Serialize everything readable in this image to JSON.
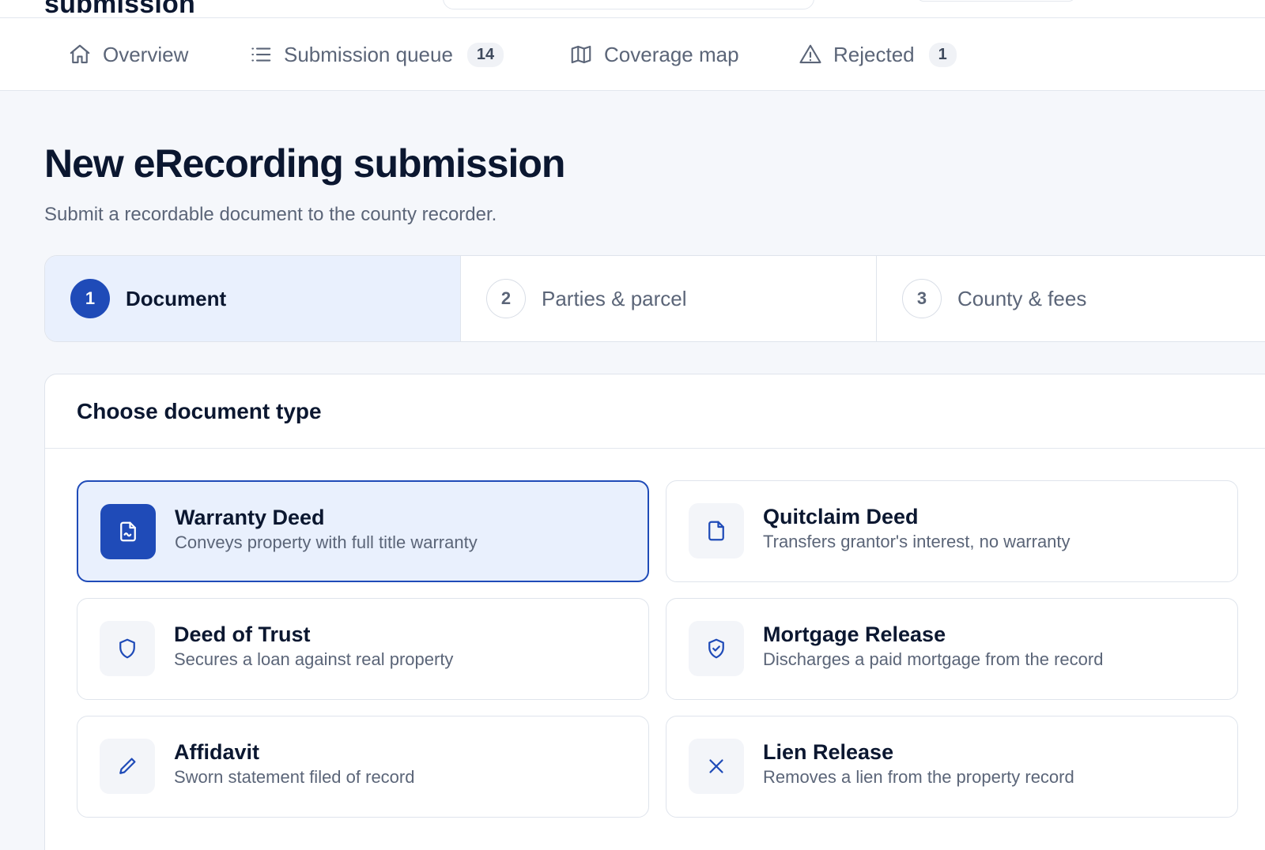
{
  "app": {
    "brand_text": "submission"
  },
  "nav": {
    "items": [
      {
        "label": "Overview",
        "icon": "home-icon"
      },
      {
        "label": "Submission queue",
        "icon": "list-icon",
        "badge": "14"
      },
      {
        "label": "Coverage map",
        "icon": "map-icon"
      },
      {
        "label": "Rejected",
        "icon": "warning-icon",
        "badge": "1"
      }
    ]
  },
  "page": {
    "title": "New eRecording submission",
    "subtitle": "Submit a recordable document to the county recorder."
  },
  "stepper": {
    "steps": [
      {
        "number": "1",
        "label": "Document",
        "active": true
      },
      {
        "number": "2",
        "label": "Parties & parcel",
        "active": false
      },
      {
        "number": "3",
        "label": "County & fees",
        "active": false
      }
    ]
  },
  "document_type": {
    "title": "Choose document type",
    "options": [
      {
        "name": "Warranty Deed",
        "description": "Conveys property with full title warranty",
        "icon": "signed-document-icon",
        "selected": true
      },
      {
        "name": "Quitclaim Deed",
        "description": "Transfers grantor's interest, no warranty",
        "icon": "document-icon",
        "selected": false
      },
      {
        "name": "Deed of Trust",
        "description": "Secures a loan against real property",
        "icon": "shield-icon",
        "selected": false
      },
      {
        "name": "Mortgage Release",
        "description": "Discharges a paid mortgage from the record",
        "icon": "shield-check-icon",
        "selected": false
      },
      {
        "name": "Affidavit",
        "description": "Sworn statement filed of record",
        "icon": "pencil-icon",
        "selected": false
      },
      {
        "name": "Lien Release",
        "description": "Removes a lien from the property record",
        "icon": "close-icon",
        "selected": false
      }
    ]
  },
  "colors": {
    "accent": "#1f4bb8",
    "accent_light": "#e9f0fd",
    "page_background": "#f5f7fb"
  }
}
